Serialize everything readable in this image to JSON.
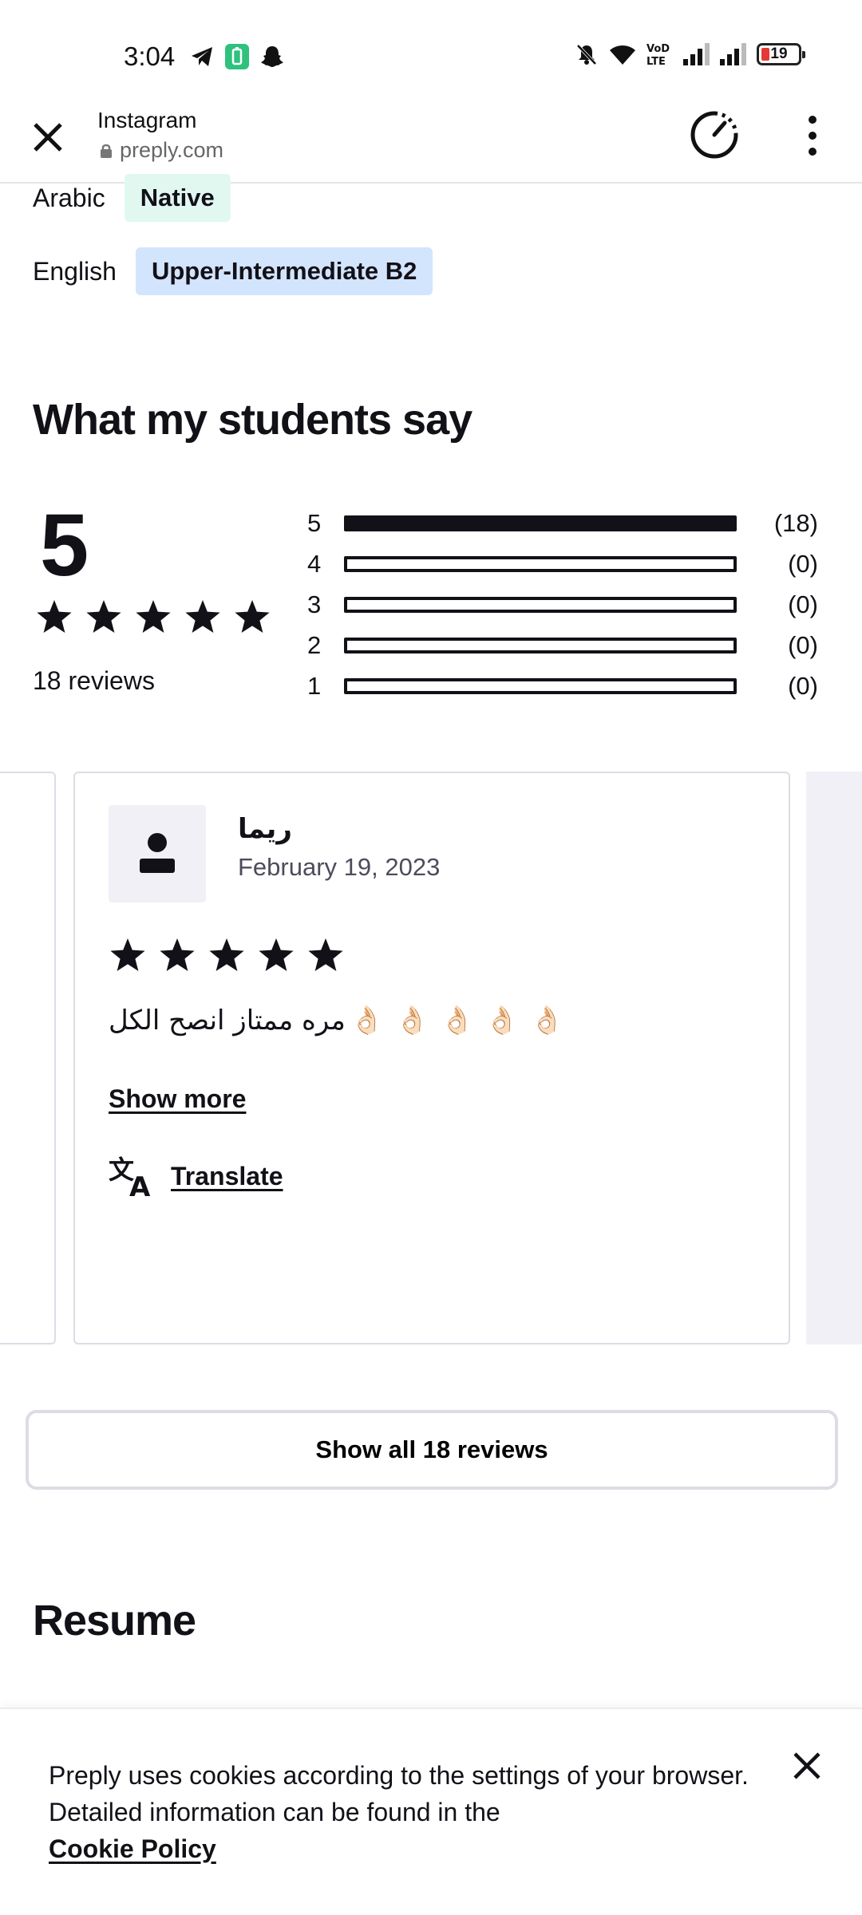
{
  "status_bar": {
    "time": "3:04",
    "battery_level": "19",
    "icons_left": [
      "telegram-icon",
      "battery-saver-icon",
      "snapchat-icon"
    ],
    "icons_right": [
      "mute-icon",
      "wifi-icon",
      "volte-icon",
      "signal-icon",
      "signal-icon",
      "battery-icon"
    ]
  },
  "browser": {
    "title": "Instagram",
    "url": "preply.com"
  },
  "languages": [
    {
      "name": "Arabic",
      "level": "Native",
      "color": "#e1f8f1"
    },
    {
      "name": "English",
      "level": "Upper-Intermediate B2",
      "color": "#d3e4fd"
    }
  ],
  "reviews_section": {
    "title": "What my students say",
    "score": "5",
    "reviews_count_label": "18 reviews",
    "distribution": [
      {
        "stars": "5",
        "count": "(18)",
        "fraction": 1.0
      },
      {
        "stars": "4",
        "count": "(0)",
        "fraction": 0
      },
      {
        "stars": "3",
        "count": "(0)",
        "fraction": 0
      },
      {
        "stars": "2",
        "count": "(0)",
        "fraction": 0
      },
      {
        "stars": "1",
        "count": "(0)",
        "fraction": 0
      }
    ],
    "review": {
      "name": "ريما",
      "date": "February 19, 2023",
      "rating": 5,
      "text": "مره ممتاز انصح الكل",
      "emoji": "👌🏻",
      "show_more": "Show more",
      "translate": "Translate"
    },
    "show_all_button": "Show all 18 reviews"
  },
  "resume_section": {
    "title": "Resume"
  },
  "cookie_banner": {
    "text": "Preply uses cookies according to the settings of your browser. Detailed information can be found in the",
    "link": "Cookie Policy"
  }
}
